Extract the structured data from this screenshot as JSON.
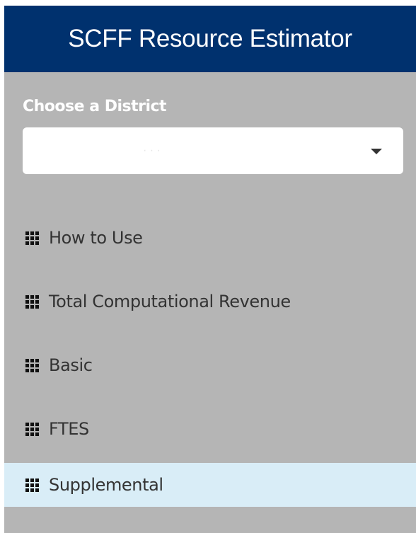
{
  "header": {
    "title": "SCFF Resource Estimator"
  },
  "district": {
    "label": "Choose a District",
    "selected_value": "· · ·"
  },
  "menu": {
    "items": [
      {
        "label": "How to Use",
        "icon": "th-icon"
      },
      {
        "label": "Total Computational Revenue",
        "icon": "th-icon"
      },
      {
        "label": "Basic",
        "icon": "th-icon"
      },
      {
        "label": "FTES",
        "icon": "th-icon"
      },
      {
        "label": "Supplemental",
        "icon": "th-icon",
        "active": true
      }
    ]
  },
  "colors": {
    "header_bg": "#00316e",
    "sidebar_bg": "#b5b5b5",
    "active_item_bg": "#d9edf7"
  }
}
